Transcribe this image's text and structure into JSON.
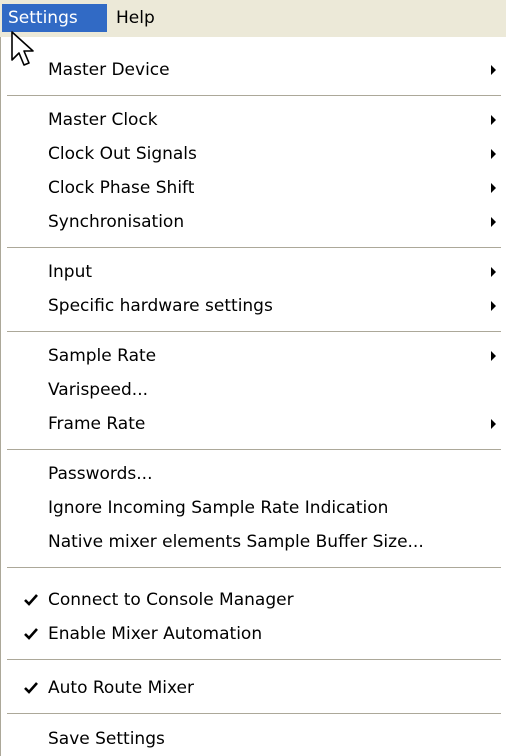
{
  "menubar": {
    "settings": "Settings",
    "help": "Help"
  },
  "menu": {
    "master_device": "Master Device",
    "master_clock": "Master Clock",
    "clock_out_signals": "Clock Out Signals",
    "clock_phase_shift": "Clock Phase Shift",
    "synchronisation": "Synchronisation",
    "input": "Input",
    "specific_hardware_settings": "Specific hardware settings",
    "sample_rate": "Sample Rate",
    "varispeed": "Varispeed...",
    "frame_rate": "Frame Rate",
    "passwords": "Passwords...",
    "ignore_incoming": "Ignore Incoming Sample Rate Indication",
    "native_mixer": "Native mixer elements Sample Buffer Size...",
    "connect_console": "Connect to Console Manager",
    "enable_automation": "Enable Mixer Automation",
    "auto_route": "Auto Route Mixer",
    "save_settings": "Save Settings"
  },
  "checked": {
    "connect_console": true,
    "enable_automation": true,
    "auto_route": true
  },
  "icons": {
    "submenu": "chevron-right-icon",
    "check": "checkmark-icon",
    "cursor": "mouse-pointer-icon"
  },
  "colors": {
    "menubar_bg": "#ece9d8",
    "highlight": "#316ac5",
    "separator": "#aca899"
  }
}
